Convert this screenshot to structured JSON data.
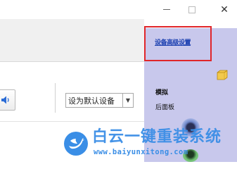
{
  "window": {
    "minimize_icon": "minimize-icon",
    "maximize_icon": "maximize-icon",
    "close_icon": "close-icon",
    "close_glyph": "✕"
  },
  "device": {
    "set_default_label": "设为默认设备",
    "dropdown_arrow": "▼"
  },
  "right_panel": {
    "advanced_link": "设备高级设置",
    "section_title": "模拟",
    "section_subtitle": "后面板",
    "highlight_color": "#e0262a",
    "panel_color": "#c8c8ec"
  },
  "watermark": {
    "title": "白云一键重装系统",
    "url": "www.baiyunxitong.com",
    "color": "#3a8ee6"
  }
}
